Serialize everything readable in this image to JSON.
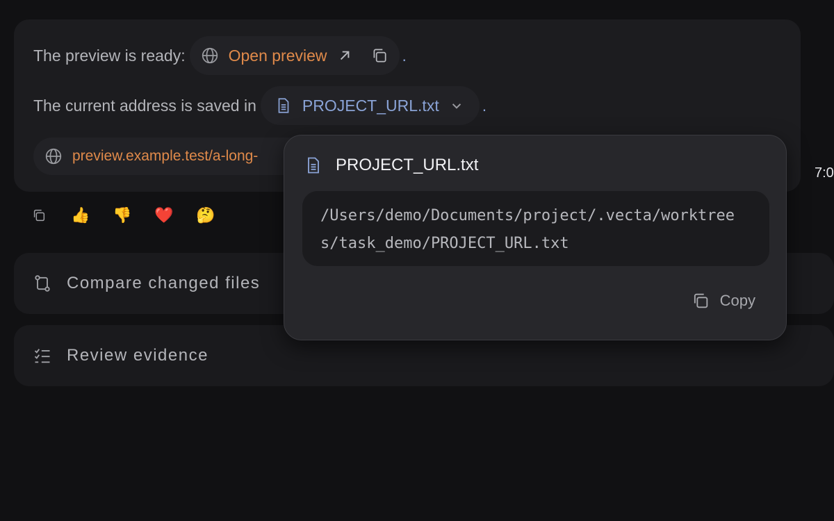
{
  "message": {
    "line1_text": "The preview is ready:",
    "open_preview_label": "Open preview",
    "line1_end": ".",
    "line2_text": "The current address is saved in",
    "file_chip_label": "PROJECT_URL.txt",
    "line2_end": ".",
    "url_partial": "preview.example.test/a-long-",
    "time_partial": "7:0"
  },
  "reactions": [
    "👍",
    "👎",
    "❤️",
    "🤔"
  ],
  "actions": {
    "compare_label": "Compare changed files",
    "review_label": "Review evidence"
  },
  "popover": {
    "title": "PROJECT_URL.txt",
    "path": "/Users/demo/Documents/project/.vecta/worktrees/task_demo/PROJECT_URL.txt",
    "copy_label": "Copy"
  },
  "colors": {
    "accent_orange": "#e08a4a",
    "accent_blue": "#8aa3d6",
    "background": "#111113"
  }
}
